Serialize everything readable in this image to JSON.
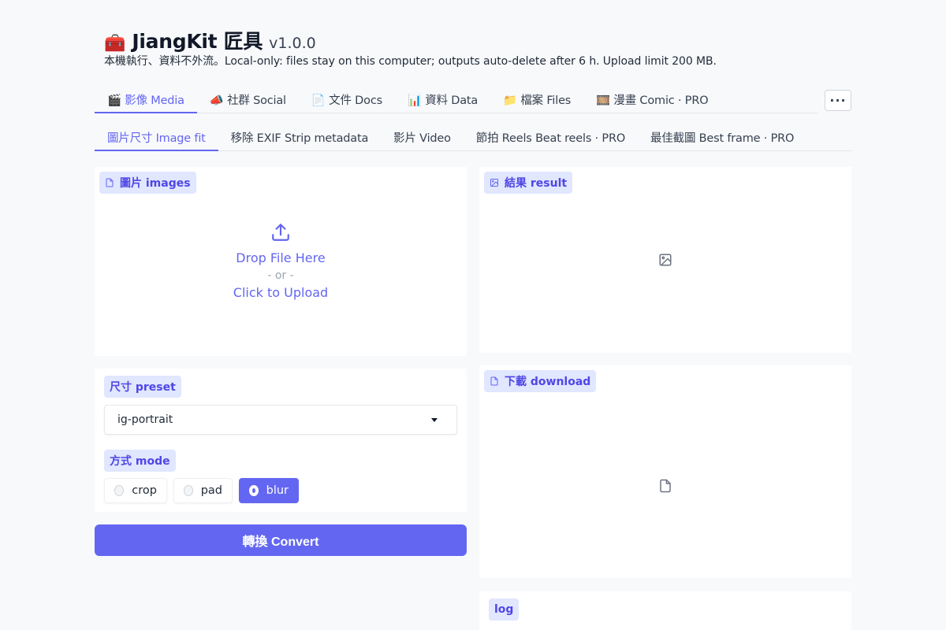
{
  "header": {
    "icon_emoji": "🧰",
    "app_name": "JiangKit 匠具",
    "version": "v1.0.0",
    "subtitle": "本機執行、資料不外流。Local-only: files stay on this computer; outputs auto-delete after 6 h. Upload limit 200 MB."
  },
  "main_tabs": [
    {
      "label": "🎬 影像 Media",
      "active": true
    },
    {
      "label": "📣 社群 Social",
      "active": false
    },
    {
      "label": "📄 文件 Docs",
      "active": false
    },
    {
      "label": "📊 資料 Data",
      "active": false
    },
    {
      "label": "📁 檔案 Files",
      "active": false
    },
    {
      "label": "🎞️ 漫畫 Comic · PRO",
      "active": false
    }
  ],
  "more_button_label": "···",
  "sub_tabs": [
    {
      "label": "圖片尺寸 Image fit",
      "active": true
    },
    {
      "label": "移除 EXIF Strip metadata",
      "active": false
    },
    {
      "label": "影片 Video",
      "active": false
    },
    {
      "label": "節拍 Reels Beat reels · PRO",
      "active": false
    },
    {
      "label": "最佳截圖 Best frame · PRO",
      "active": false
    }
  ],
  "images_panel": {
    "label": "圖片 images",
    "icon": "file-icon",
    "drop_text": "Drop File Here",
    "or_text": "- or -",
    "click_text": "Click to Upload"
  },
  "result_panel": {
    "label": "結果 result",
    "icon": "image-icon"
  },
  "download_panel": {
    "label": "下載 download",
    "icon": "file-icon"
  },
  "log_panel": {
    "label": "log"
  },
  "options": {
    "preset_label": "尺寸 preset",
    "preset_value": "ig-portrait",
    "mode_label": "方式 mode",
    "modes": [
      {
        "label": "crop",
        "selected": false
      },
      {
        "label": "pad",
        "selected": false
      },
      {
        "label": "blur",
        "selected": true
      }
    ]
  },
  "convert_button": "轉換 Convert",
  "colors": {
    "accent": "#6366f1",
    "label_bg": "#e0e7ff",
    "label_text": "#4f46e5",
    "page_bg": "#f8f9fb"
  }
}
